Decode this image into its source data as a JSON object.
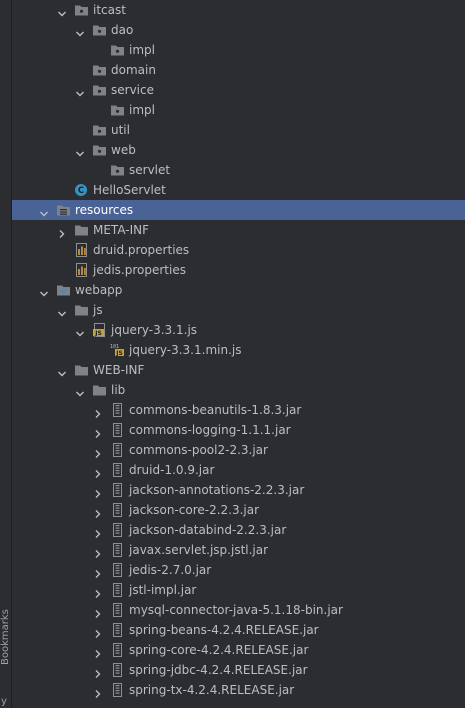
{
  "sidebar": {
    "bookmarks_label": "Bookmarks",
    "cut_label": "y"
  },
  "tree": [
    {
      "label": "itcast",
      "icon": "package-icon",
      "expander": "expanded",
      "depth": 3
    },
    {
      "label": "dao",
      "icon": "package-icon",
      "expander": "expanded",
      "depth": 4
    },
    {
      "label": "impl",
      "icon": "package-icon",
      "expander": "none",
      "depth": 5
    },
    {
      "label": "domain",
      "icon": "package-icon",
      "expander": "none",
      "depth": 4
    },
    {
      "label": "service",
      "icon": "package-icon",
      "expander": "expanded",
      "depth": 4
    },
    {
      "label": "impl",
      "icon": "package-icon",
      "expander": "none",
      "depth": 5
    },
    {
      "label": "util",
      "icon": "package-icon",
      "expander": "none",
      "depth": 4
    },
    {
      "label": "web",
      "icon": "package-icon",
      "expander": "expanded",
      "depth": 4
    },
    {
      "label": "servlet",
      "icon": "package-icon",
      "expander": "none",
      "depth": 5
    },
    {
      "label": "HelloServlet",
      "icon": "java-class-icon",
      "expander": "none",
      "depth": 3
    },
    {
      "label": "resources",
      "icon": "resources-folder-icon",
      "expander": "expanded",
      "depth": 2,
      "selected": true
    },
    {
      "label": "META-INF",
      "icon": "folder-icon",
      "expander": "collapsed",
      "depth": 3
    },
    {
      "label": "druid.properties",
      "icon": "properties-file-icon",
      "expander": "none",
      "depth": 3
    },
    {
      "label": "jedis.properties",
      "icon": "properties-file-icon",
      "expander": "none",
      "depth": 3
    },
    {
      "label": "webapp",
      "icon": "web-folder-icon",
      "expander": "expanded",
      "depth": 2
    },
    {
      "label": "js",
      "icon": "folder-icon",
      "expander": "expanded",
      "depth": 3
    },
    {
      "label": "jquery-3.3.1.js",
      "icon": "js-file-icon",
      "expander": "expanded",
      "depth": 4
    },
    {
      "label": "jquery-3.3.1.min.js",
      "icon": "minified-js-file-icon",
      "expander": "none",
      "depth": 5
    },
    {
      "label": "WEB-INF",
      "icon": "folder-icon",
      "expander": "expanded",
      "depth": 3
    },
    {
      "label": "lib",
      "icon": "folder-icon",
      "expander": "expanded",
      "depth": 4
    },
    {
      "label": "commons-beanutils-1.8.3.jar",
      "icon": "jar-icon",
      "expander": "collapsed",
      "depth": 5
    },
    {
      "label": "commons-logging-1.1.1.jar",
      "icon": "jar-icon",
      "expander": "collapsed",
      "depth": 5
    },
    {
      "label": "commons-pool2-2.3.jar",
      "icon": "jar-icon",
      "expander": "collapsed",
      "depth": 5
    },
    {
      "label": "druid-1.0.9.jar",
      "icon": "jar-icon",
      "expander": "collapsed",
      "depth": 5
    },
    {
      "label": "jackson-annotations-2.2.3.jar",
      "icon": "jar-icon",
      "expander": "collapsed",
      "depth": 5
    },
    {
      "label": "jackson-core-2.2.3.jar",
      "icon": "jar-icon",
      "expander": "collapsed",
      "depth": 5
    },
    {
      "label": "jackson-databind-2.2.3.jar",
      "icon": "jar-icon",
      "expander": "collapsed",
      "depth": 5
    },
    {
      "label": "javax.servlet.jsp.jstl.jar",
      "icon": "jar-icon",
      "expander": "collapsed",
      "depth": 5
    },
    {
      "label": "jedis-2.7.0.jar",
      "icon": "jar-icon",
      "expander": "collapsed",
      "depth": 5
    },
    {
      "label": "jstl-impl.jar",
      "icon": "jar-icon",
      "expander": "collapsed",
      "depth": 5
    },
    {
      "label": "mysql-connector-java-5.1.18-bin.jar",
      "icon": "jar-icon",
      "expander": "collapsed",
      "depth": 5
    },
    {
      "label": "spring-beans-4.2.4.RELEASE.jar",
      "icon": "jar-icon",
      "expander": "collapsed",
      "depth": 5
    },
    {
      "label": "spring-core-4.2.4.RELEASE.jar",
      "icon": "jar-icon",
      "expander": "collapsed",
      "depth": 5
    },
    {
      "label": "spring-jdbc-4.2.4.RELEASE.jar",
      "icon": "jar-icon",
      "expander": "collapsed",
      "depth": 5
    },
    {
      "label": "spring-tx-4.2.4.RELEASE.jar",
      "icon": "jar-icon",
      "expander": "collapsed",
      "depth": 5
    }
  ],
  "colors": {
    "background": "#2b2d30",
    "selection": "#4a6397",
    "text": "#bcbec4",
    "folder": "#7e8289",
    "package_dot": "#2b2d30",
    "java_class": "#3592c4",
    "js_badge": "#c7a13a",
    "properties": "#b58a3c",
    "web_badge": "#3d8fc9"
  }
}
